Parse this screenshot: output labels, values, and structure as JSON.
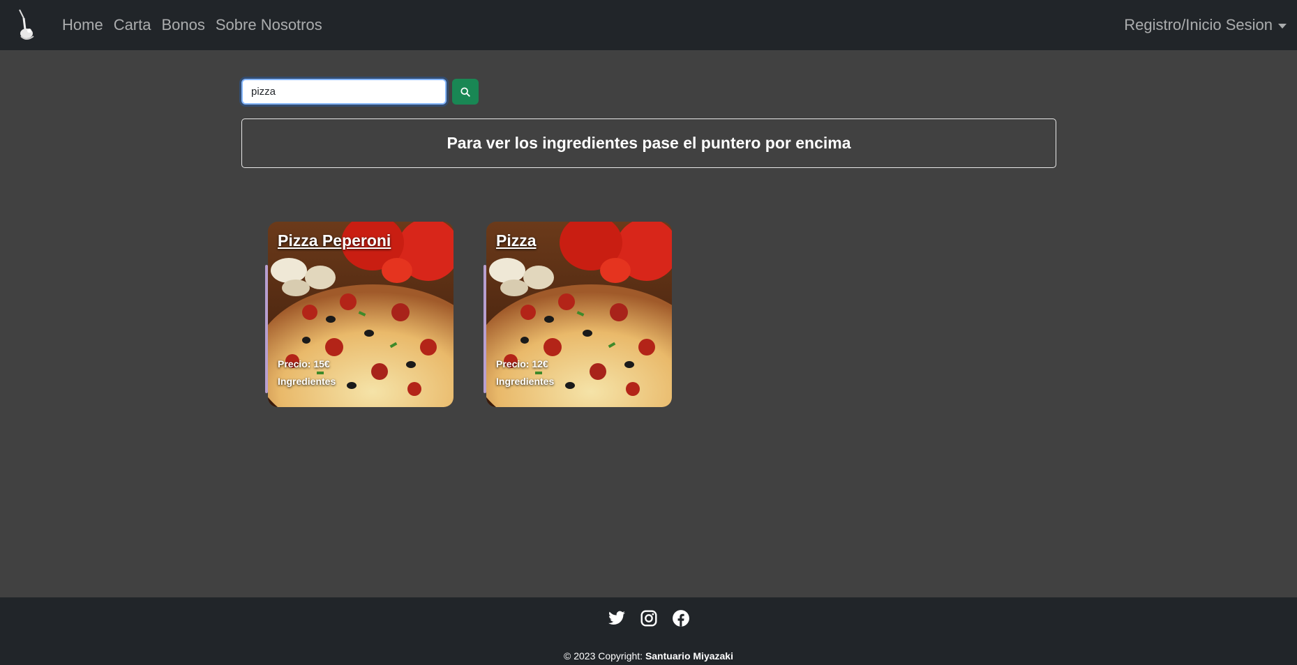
{
  "navbar": {
    "brand_icon": "lamp-logo-icon",
    "links": [
      "Home",
      "Carta",
      "Bonos",
      "Sobre Nosotros"
    ],
    "account_label": "Registro/Inicio Sesion"
  },
  "search": {
    "value": "pizza",
    "button_icon": "search-icon",
    "button_color": "#198754"
  },
  "info": {
    "message": "Para ver los ingredientes pase el puntero por encima"
  },
  "products": [
    {
      "name": "Pizza Peperoni",
      "price": "Precio: 15€",
      "ingredients_label": "Ingredientes"
    },
    {
      "name": "Pizza",
      "price": "Precio: 12€",
      "ingredients_label": "Ingredientes"
    }
  ],
  "footer": {
    "social_icons": [
      "twitter-icon",
      "instagram-icon",
      "facebook-icon"
    ],
    "copyright_prefix": "© 2023 Copyright: ",
    "copyright_owner": "Santuario Miyazaki"
  },
  "colors": {
    "navbar_bg": "#212529",
    "page_bg": "#414141",
    "accent": "#b79fd0"
  }
}
